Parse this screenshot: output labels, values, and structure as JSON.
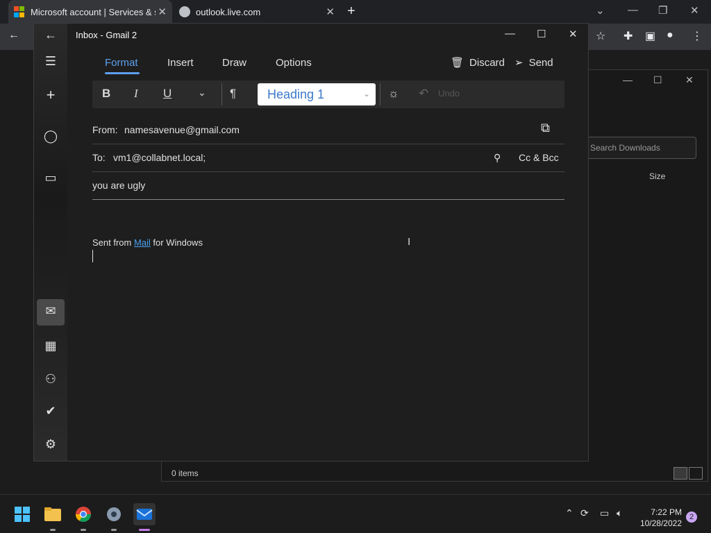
{
  "browser": {
    "tabs": [
      {
        "label": "Microsoft account | Services & su"
      },
      {
        "label": "outlook.live.com"
      }
    ],
    "new_tab": "+"
  },
  "explorer": {
    "search_placeholder": "Search Downloads",
    "column_size": "Size",
    "status": "0 items"
  },
  "mail": {
    "window_title": "Inbox - Gmail 2",
    "ribbon_tabs": [
      "Format",
      "Insert",
      "Draw",
      "Options"
    ],
    "active_tab": "Format",
    "discard_label": "Discard",
    "send_label": "Send",
    "toolbar": {
      "bold": "B",
      "italic": "I",
      "underline": "U",
      "style_value": "Heading 1",
      "undo_label": "Undo"
    },
    "from_label": "From:",
    "from_value": "namesavenue@gmail.com",
    "to_label": "To:",
    "to_value": "vm1@collabnet.local;",
    "cc_bcc_label": "Cc & Bcc",
    "subject": "you are ugly",
    "signature_prefix": "Sent from ",
    "signature_link": "Mail",
    "signature_suffix": " for Windows"
  },
  "taskbar": {
    "time": "7:22 PM",
    "date": "10/28/2022",
    "notification_count": "2"
  },
  "colors": {
    "accent": "#5ea0ef",
    "link": "#4aa0f0",
    "badge": "#c9a6f2"
  }
}
